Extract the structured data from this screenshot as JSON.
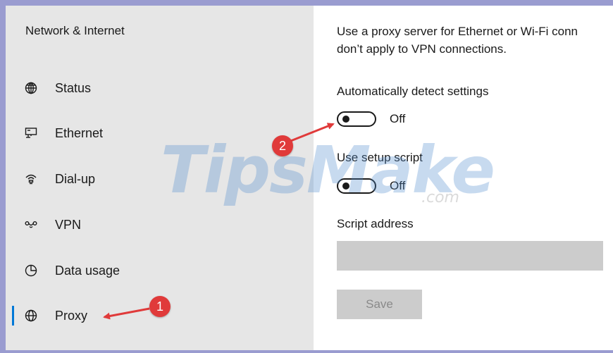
{
  "sidebar": {
    "title": "Network & Internet",
    "items": [
      {
        "label": "Status",
        "icon": "status-globe-icon"
      },
      {
        "label": "Ethernet",
        "icon": "ethernet-icon"
      },
      {
        "label": "Dial-up",
        "icon": "dial-up-icon"
      },
      {
        "label": "VPN",
        "icon": "vpn-icon"
      },
      {
        "label": "Data usage",
        "icon": "data-usage-icon"
      },
      {
        "label": "Proxy",
        "icon": "proxy-globe-icon"
      }
    ],
    "active_item": "Proxy"
  },
  "content": {
    "description_line1": "Use a proxy server for Ethernet or Wi-Fi conn",
    "description_line2": "don’t apply to VPN connections.",
    "auto_detect": {
      "label": "Automatically detect settings",
      "state": "Off"
    },
    "setup_script": {
      "label": "Use setup script",
      "state": "Off"
    },
    "script_address": {
      "label": "Script address",
      "value": ""
    },
    "save_label": "Save"
  },
  "annotations": {
    "badge1": "1",
    "badge2": "2"
  },
  "watermark": {
    "text": "TipsMake",
    "suffix": ".com"
  },
  "colors": {
    "accent": "#0078d7",
    "badge": "#e03a3a",
    "frame": "#9a9cd0"
  }
}
